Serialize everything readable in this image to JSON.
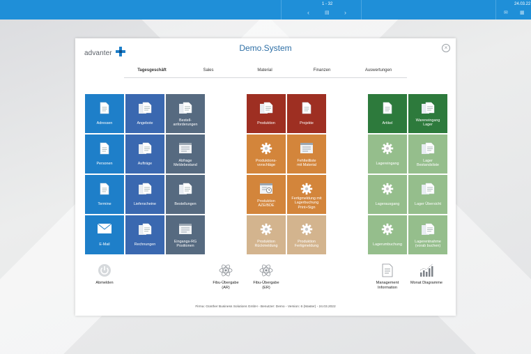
{
  "topbar": {
    "pager": "1 - 32",
    "date": "24.03.22",
    "icons": [
      "chevron-left-icon",
      "list-icon",
      "chevron-right-icon",
      "mail-icon",
      "calendar-icon"
    ]
  },
  "window": {
    "logo": "advanter",
    "title": "Demo.System",
    "close_glyph": "×"
  },
  "tabs": [
    "Tagesgeschäft",
    "Sales",
    "Material",
    "Finanzen",
    "Auswertungen"
  ],
  "tiles": [
    {
      "name": "adressen",
      "label": [
        "Adressen"
      ],
      "icon": "document-icon",
      "color": "blue"
    },
    {
      "name": "angebote",
      "label": [
        "Angebote"
      ],
      "icon": "documents-icon",
      "color": "navy"
    },
    {
      "name": "bestellanforderungen",
      "label": [
        "Bestell-",
        "anforderungen"
      ],
      "icon": "documents-icon",
      "color": "slate"
    },
    {
      "name": "personen",
      "label": [
        "Personen"
      ],
      "icon": "document-icon",
      "color": "blue"
    },
    {
      "name": "auftraege",
      "label": [
        "Aufträge"
      ],
      "icon": "documents-icon",
      "color": "navy"
    },
    {
      "name": "abfrage-meldebestand",
      "label": [
        "Abfrage",
        "Meldebestand"
      ],
      "icon": "form-icon",
      "color": "slate"
    },
    {
      "name": "termine",
      "label": [
        "Termine"
      ],
      "icon": "document-icon",
      "color": "blue"
    },
    {
      "name": "lieferscheine",
      "label": [
        "Lieferscheine"
      ],
      "icon": "documents-icon",
      "color": "navy"
    },
    {
      "name": "bestellungen",
      "label": [
        "Bestellungen"
      ],
      "icon": "documents-icon",
      "color": "slate"
    },
    {
      "name": "email",
      "label": [
        "E-Mail"
      ],
      "icon": "mail-icon",
      "color": "blue"
    },
    {
      "name": "rechnungen",
      "label": [
        "Rechnungen"
      ],
      "icon": "documents-icon",
      "color": "navy"
    },
    {
      "name": "eingangs-rg-positionen",
      "label": [
        "Eingangs-RG",
        "Positionen"
      ],
      "icon": "form-icon",
      "color": "slate"
    },
    {
      "name": "produktion",
      "label": [
        "Produktion"
      ],
      "icon": "documents-icon",
      "color": "red"
    },
    {
      "name": "projekte",
      "label": [
        "Projekte"
      ],
      "icon": "document-icon",
      "color": "red"
    },
    {
      "name": "produktionsvorschlaege",
      "label": [
        "Produktions-",
        "vorschläge"
      ],
      "icon": "gear-icon",
      "color": "orange"
    },
    {
      "name": "fehlteilliste",
      "label": [
        "Fehlteilliste",
        "mit Material"
      ],
      "icon": "form-icon",
      "color": "orange"
    },
    {
      "name": "produktion-aze-bde",
      "label": [
        "Produktion",
        "AZE/BDE"
      ],
      "icon": "clock-form-icon",
      "color": "orange"
    },
    {
      "name": "fertigmeldung-lagerbuchung",
      "label": [
        "Fertigmeldung mit",
        "Lagerbuchung",
        "Print+Sign"
      ],
      "icon": "gear-icon",
      "color": "orange"
    },
    {
      "name": "produktion-rueckmeldung",
      "label": [
        "Produktion",
        "Rückmeldung"
      ],
      "icon": "gear-icon",
      "color": "tan"
    },
    {
      "name": "produktion-fertigmeldung",
      "label": [
        "Produktion",
        "Fertigmeldung"
      ],
      "icon": "gear-icon",
      "color": "tan"
    },
    {
      "name": "artikel",
      "label": [
        "Artikel"
      ],
      "icon": "document-icon",
      "color": "dgreen"
    },
    {
      "name": "wareneingang-lager",
      "label": [
        "Wareneingang",
        "Lager"
      ],
      "icon": "documents-icon",
      "color": "dgreen"
    },
    {
      "name": "lagereingang",
      "label": [
        "Lagereingang"
      ],
      "icon": "gear-icon",
      "color": "lgreen"
    },
    {
      "name": "lager-bestandsliste",
      "label": [
        "Lager",
        "Bestandsliste"
      ],
      "icon": "documents-icon",
      "color": "lgreen"
    },
    {
      "name": "lagerausgang",
      "label": [
        "Lagerausgang"
      ],
      "icon": "gear-icon",
      "color": "lgreen"
    },
    {
      "name": "lager-uebersicht",
      "label": [
        "Lager Übersicht"
      ],
      "icon": "documents-icon",
      "color": "lgreen"
    },
    {
      "name": "lagerumbuchung",
      "label": [
        "Lagerumbuchung"
      ],
      "icon": "gear-icon",
      "color": "lgreen"
    },
    {
      "name": "lagerentnahme",
      "label": [
        "Lagerentnahme",
        "(vorab buchen)"
      ],
      "icon": "documents-icon",
      "color": "lgreen"
    }
  ],
  "bottom": [
    {
      "name": "abmelden",
      "label": [
        "Abmelden"
      ],
      "icon": "power-icon"
    },
    {
      "name": "fibu-uebergabe-ar",
      "label": [
        "Fibu-Übergabe",
        "(AR)"
      ],
      "icon": "atom-icon"
    },
    {
      "name": "fibu-uebergabe-er",
      "label": [
        "Fibu-Übergabe",
        "(ER)"
      ],
      "icon": "atom-icon"
    },
    {
      "name": "management-information",
      "label": [
        "Management",
        "Information"
      ],
      "icon": "report-icon"
    },
    {
      "name": "monat-diagramme",
      "label": [
        "Monat Diagramme"
      ],
      "icon": "bar-chart-icon"
    }
  ],
  "footer": "Firma: Günther Business Solutions GmbH - Benutzer: Demo - Version: 6 (Master) - 24.03.2022",
  "colors": {
    "topbar": "#1f8fd8",
    "blue": "#1e7fc9",
    "navy": "#3a68b0",
    "slate": "#566a80",
    "red": "#9e2f22",
    "orange": "#d3853b",
    "tan": "#d3b48e",
    "dgreen": "#2d7a3c",
    "lgreen": "#95be8c"
  }
}
